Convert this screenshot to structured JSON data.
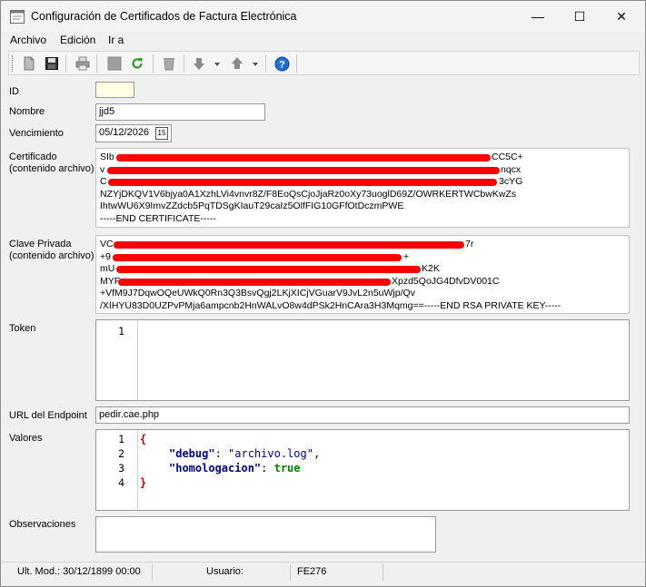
{
  "window": {
    "title": "Configuración de Certificados de Factura Electrónica",
    "minimize": "—",
    "maximize": "☐",
    "close": "✕"
  },
  "menu": {
    "file": "Archivo",
    "edit": "Edición",
    "goto": "Ir a"
  },
  "toolbar": {
    "icons": [
      "new-icon",
      "save-icon",
      "print-icon",
      "stop-icon",
      "refresh-icon",
      "delete-icon",
      "move-down-icon",
      "move-up-icon",
      "help-icon"
    ],
    "help_glyph": "?"
  },
  "form": {
    "id_label": "ID",
    "id_value": "",
    "name_label": "Nombre",
    "name_value": "jjd5",
    "expiry_label": "Vencimiento",
    "expiry_value": "05/12/2026",
    "calendar_glyph": "15",
    "cert_label": "Certificado\n(contenido archivo)",
    "cert_lines": [
      "SIb",
      "CC5C+",
      "v",
      "nqcx",
      "C",
      "3cYG",
      "NZYjDKQV1V6bjya0A1XzhLVi4vnvr8Z/F8EoQsCjoJjaRz0oXy73uoglD69Z/OWRKERTWCbwKwZs",
      "IhtwWU6X9ImvZZdcb5PqTDSgKIauT29caIz5OlfFIG10GFfOtDczmPWE",
      "-----END CERTIFICATE-----"
    ],
    "key_label": "Clave Privada\n(contenido archivo)",
    "key_lines": [
      "VC",
      "7r",
      "+9",
      "+",
      "mU",
      "K2K",
      "MYF",
      "Xpzd5QoJG4DfvDV001C",
      "+VfM9J7DqwOQeUWkQ0Rn3Q3BsvQgj2LKjXICjVGuarV9JvL2n5uWjp/Qv",
      "/XIHYU83D0UZPvPMja6ampcnb2HnWALvO8w4dPSk2HnCAra3H3Mqmg==-----END RSA PRIVATE KEY-----"
    ],
    "token_label": "Token",
    "token_line_no": "1",
    "endpoint_label": "URL del Endpoint",
    "endpoint_value": "pedir.cae.php",
    "values_label": "Valores",
    "values_line_nos": [
      "1",
      "2",
      "3",
      "4"
    ],
    "values_code": {
      "open_brace": "{",
      "k1": "\"debug\"",
      "colon1": ": ",
      "v1": "\"archivo.log\"",
      "comma1": ",",
      "k2": "\"homologacion\"",
      "colon2": ": ",
      "v2": "true",
      "close_brace": "}"
    },
    "notes_label": "Observaciones",
    "notes_value": ""
  },
  "status": {
    "last_mod": "Ult. Mod.: 30/12/1899 00:00",
    "user": "Usuario:",
    "code": "FE276"
  },
  "colors": {
    "redaction": "#ff0000",
    "json_key": "#00008b",
    "json_value_bool": "#008000",
    "brace": "#cc0000"
  }
}
